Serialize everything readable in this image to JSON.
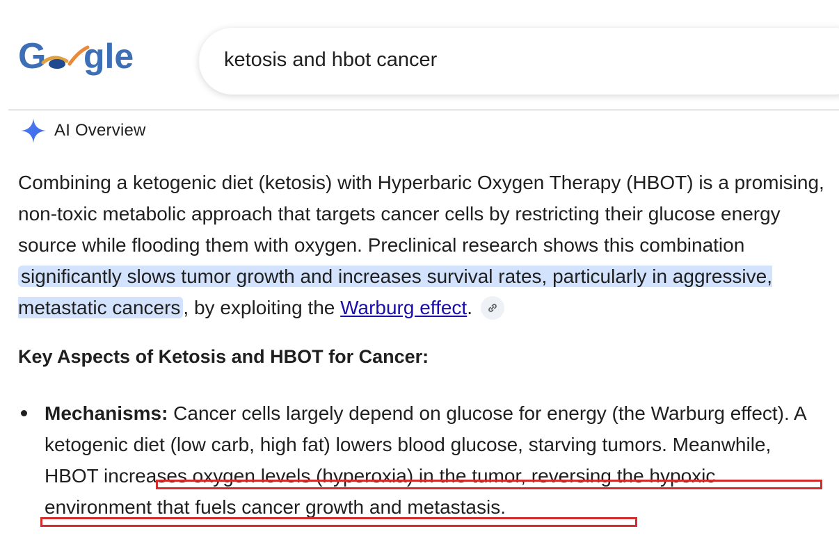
{
  "header": {
    "logo_text": "Google",
    "search_query": "ketosis and hbot cancer"
  },
  "ai_overview": {
    "label": "AI Overview",
    "summary_lead": "Combining a ketogenic diet (ketosis) with Hyperbaric Oxygen Therapy (HBOT) is a promising, non-toxic metabolic approach that targets cancer cells by restricting their glucose energy source while flooding them with oxygen. Preclinical research shows this combination ",
    "summary_highlight": "significantly slows tumor growth and increases survival rates, particularly in aggressive, metastatic cancers",
    "summary_mid": ", by exploiting the ",
    "summary_link": "Warburg effect",
    "summary_end": "."
  },
  "section": {
    "title": "Key Aspects of Ketosis and HBOT for Cancer:"
  },
  "bullets": [
    {
      "term": "Mechanisms:",
      "text_1": " Cancer cells largely depend on glucose for energy (the Warburg effect). A ketogenic diet (low carb, high fat) lowers blood glucose, starving tumors. Meanwhile, ",
      "text_2": "HBOT increases oxygen levels (hyperoxia) in the tumor, reversing the hypoxic environment that fuels cancer growth and metastasis",
      "text_3": "."
    }
  ],
  "colors": {
    "highlight": "#d3e3fd",
    "link": "#1a0dab",
    "annotation": "#d32c2c",
    "text": "#1f1f1f"
  },
  "icons": {
    "ai": "sparkle-icon",
    "link_chip": "link-icon"
  }
}
